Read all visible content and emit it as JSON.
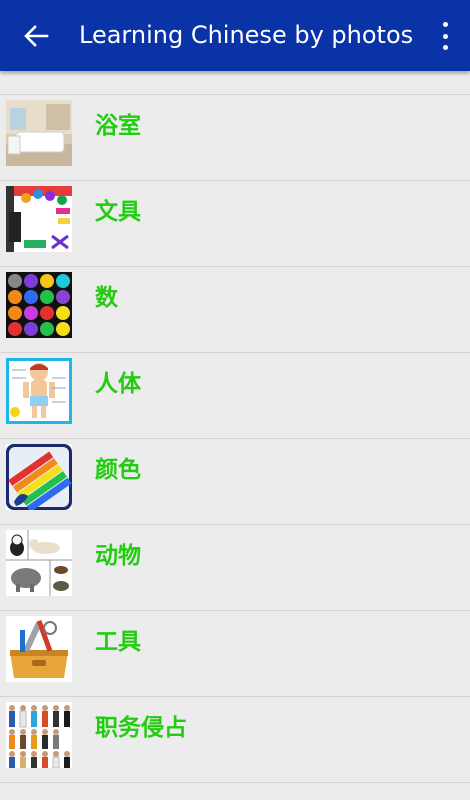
{
  "appbar": {
    "title": "Learning Chinese by photos",
    "back_icon": "arrow-left-icon",
    "menu_icon": "more-vert-icon",
    "background": "#0a33a8"
  },
  "list": {
    "label_color": "#22cc11",
    "items": [
      {
        "label": "浴室",
        "thumb_icon": "bathroom-photo"
      },
      {
        "label": "文具",
        "thumb_icon": "stationery-photo"
      },
      {
        "label": "数",
        "thumb_icon": "number-balls-photo"
      },
      {
        "label": "人体",
        "thumb_icon": "human-body-photo"
      },
      {
        "label": "颜色",
        "thumb_icon": "color-markers-photo"
      },
      {
        "label": "动物",
        "thumb_icon": "animals-photo"
      },
      {
        "label": "工具",
        "thumb_icon": "toolbox-photo"
      },
      {
        "label": "职务侵占",
        "thumb_icon": "occupations-photo"
      }
    ]
  }
}
